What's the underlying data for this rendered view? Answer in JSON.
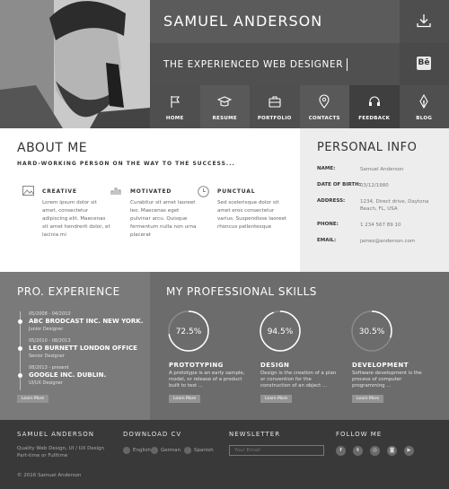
{
  "header": {
    "name": "SAMUEL ANDERSON",
    "tagline": "THE EXPERIENCED WEB DESIGNER",
    "behance": "Bē"
  },
  "nav": [
    {
      "label": "HOME",
      "icon": "flag-icon"
    },
    {
      "label": "RESUME",
      "icon": "graduation-cap-icon"
    },
    {
      "label": "PORTFOLIO",
      "icon": "briefcase-icon"
    },
    {
      "label": "CONTACTS",
      "icon": "map-pin-icon"
    },
    {
      "label": "FEEDBACK",
      "icon": "headset-icon"
    },
    {
      "label": "BLOG",
      "icon": "pen-icon"
    }
  ],
  "about": {
    "title": "ABOUT ME",
    "subtitle": "HARD-WORKING PERSON ON THE WAY TO THE SUCCESS...",
    "features": [
      {
        "title": "CREATIVE",
        "icon": "image-icon",
        "text": "Lorem ipsum dolor sit amet, consectetur adipiscing elit. Maecenas sit amet hendrerit dolor, et lacinia mi"
      },
      {
        "title": "MOTIVATED",
        "icon": "chart-icon",
        "text": "Curabitur sit amet laoreet leo. Maecenas eget pulvinar arcu. Quisque fermentum nulla non urna placerat"
      },
      {
        "title": "PUNCTUAL",
        "icon": "clock-icon",
        "text": "Sed scelerisque dolor sit amet eros consectetur varius. Suspendisse laoreet rhoncus pellentesque"
      }
    ]
  },
  "personal": {
    "title": "PERSONAL INFO",
    "rows": [
      {
        "key": "NAME:",
        "value": "Samuel Anderson"
      },
      {
        "key": "DATE OF BIRTH:",
        "value": "03/12/1980"
      },
      {
        "key": "ADDRESS:",
        "value": "1234, Direct drive, Daytona Beach, FL, USA"
      },
      {
        "key": "PHONE:",
        "value": "1 234 567 89 10"
      },
      {
        "key": "EMAIL:",
        "value": "james@anderson.com"
      }
    ]
  },
  "experience": {
    "title": "PRO. EXPERIENCE",
    "jobs": [
      {
        "dates": "05/2008 - 04/2010",
        "company": "ABC BRODCAST INC. NEW YORK.",
        "role": "Junior Designer"
      },
      {
        "dates": "05/2010 - 08/2013",
        "company": "LEO BURNETT LONDON OFFICE",
        "role": "Senior Designer"
      },
      {
        "dates": "08/2013 - present",
        "company": "GOOGLE INC. DUBLIN.",
        "role": "UI/UX Designer"
      }
    ],
    "learn_more": "Learn More"
  },
  "skills": {
    "title": "MY PROFESSIONAL SKILLS",
    "items": [
      {
        "percent_label": "72.5%",
        "percent": 72.5,
        "title": "PROTOTYPING",
        "text": "A prototype is an early sample, model, or release of a product built to test ..."
      },
      {
        "percent_label": "94.5%",
        "percent": 94.5,
        "title": "DESIGN",
        "text": "Design is the creation of a plan or convention for the construction of an object ..."
      },
      {
        "percent_label": "30.5%",
        "percent": 30.5,
        "title": "DEVELOPMENT",
        "text": "Software development is the process of computer programming ..."
      }
    ],
    "learn_more": "Learn More"
  },
  "footer": {
    "brand": "SAMUEL ANDERSON",
    "brand_line1": "Quality Web Design, UI / UX Design",
    "brand_line2": "Part-time or Fulltime",
    "copyright": "© 2016 Samuel Anderson",
    "download_title": "DOWNLOAD CV",
    "downloads": [
      "English",
      "German",
      "Spanish"
    ],
    "newsletter_title": "NEWSLETTER",
    "newsletter_placeholder": "Your Email",
    "follow_title": "FOLLOW ME",
    "social": [
      {
        "glyph": "f",
        "icon": "facebook-icon"
      },
      {
        "glyph": "t",
        "icon": "twitter-icon"
      },
      {
        "glyph": "◎",
        "icon": "dribbble-icon"
      },
      {
        "glyph": "◙",
        "icon": "instagram-icon"
      },
      {
        "glyph": "▶",
        "icon": "youtube-icon"
      }
    ]
  },
  "colors": {
    "header_dark": "#5b5b5b",
    "experience_bg": "#7a7a7a",
    "skills_bg": "#6c6c6c",
    "footer_bg": "#393939",
    "personal_bg": "#ededed"
  }
}
